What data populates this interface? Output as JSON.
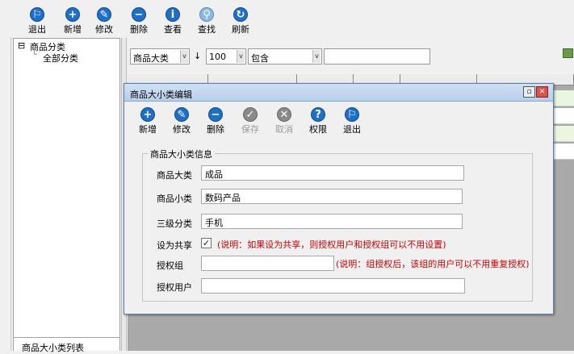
{
  "toolbar": {
    "items": [
      {
        "label": "退出",
        "icon": "exit-icon"
      },
      {
        "label": "新增",
        "icon": "add-icon"
      },
      {
        "label": "修改",
        "icon": "edit-icon"
      },
      {
        "label": "删除",
        "icon": "delete-icon"
      },
      {
        "label": "查看",
        "icon": "info-icon"
      },
      {
        "label": "查找",
        "icon": "search-icon"
      },
      {
        "label": "刷新",
        "icon": "refresh-icon"
      }
    ]
  },
  "tree": {
    "root": "商品分类",
    "toggle": "⊟",
    "child": "全部分类",
    "bottom_label": "商品大小类列表"
  },
  "filter": {
    "field": "商品大类",
    "sort_arrow": "↓",
    "count": "100",
    "operator": "包含",
    "value": ""
  },
  "dialog": {
    "title": "商品大小类编辑",
    "toolbar": [
      {
        "label": "新增",
        "icon": "add-icon",
        "enabled": true
      },
      {
        "label": "修改",
        "icon": "edit-icon",
        "enabled": true
      },
      {
        "label": "删除",
        "icon": "delete-icon",
        "enabled": true
      },
      {
        "label": "保存",
        "icon": "save-icon",
        "enabled": false
      },
      {
        "label": "取消",
        "icon": "cancel-icon",
        "enabled": false
      },
      {
        "label": "权限",
        "icon": "help-icon",
        "enabled": true
      },
      {
        "label": "退出",
        "icon": "exit-icon",
        "enabled": true
      }
    ],
    "group_title": "商品大小类信息",
    "fields": {
      "category_label": "商品大类",
      "category_value": "成品",
      "subcategory_label": "商品小类",
      "subcategory_value": "数码产品",
      "level3_label": "三级分类",
      "level3_value": "手机",
      "shared_label": "设为共享",
      "shared_checked": "✓",
      "shared_note": "(说明：如果设为共享，则授权用户和授权组可以不用设置)",
      "group_label": "授权组",
      "group_value": "",
      "group_note": "(说明：组授权后，该组的用户可以不用重复授权)",
      "user_label": "授权用户",
      "user_value": ""
    }
  },
  "colors": {
    "icon_blue": "#1e6fc7",
    "note_red": "#d00000",
    "title_bar": "#c3d8ef"
  }
}
